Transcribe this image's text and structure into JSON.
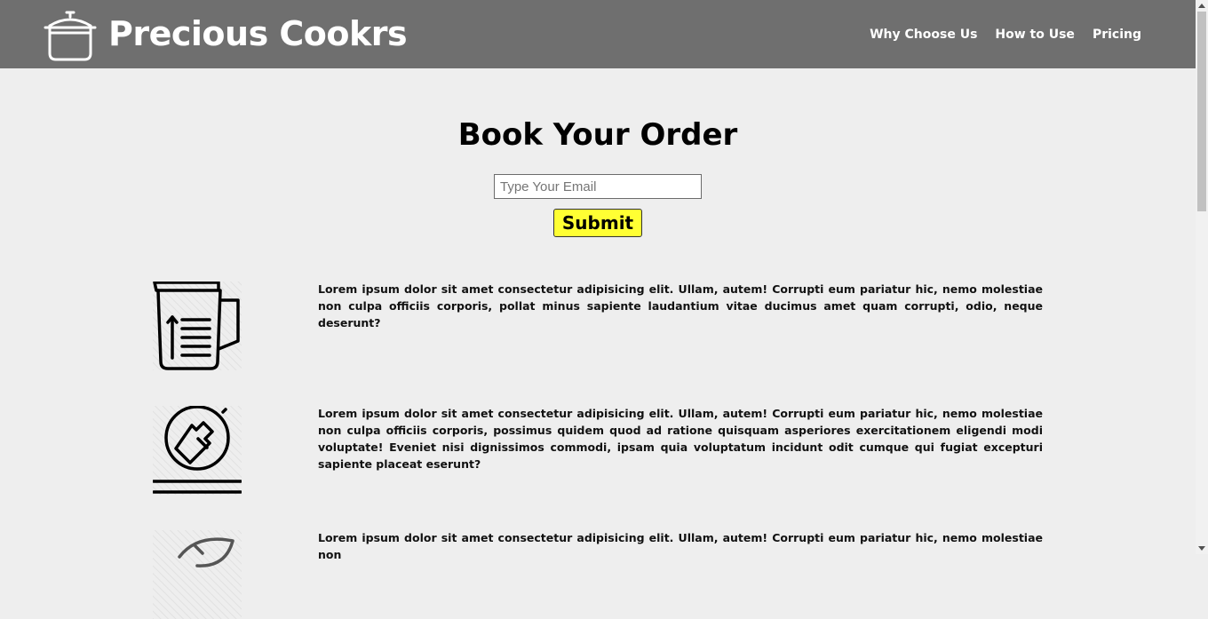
{
  "header": {
    "brand": "Precious Cookrs",
    "logo_icon": "cooking-pot-icon",
    "nav": [
      "Why Choose Us",
      "How to Use",
      "Pricing"
    ]
  },
  "booking": {
    "title": "Book Your Order",
    "email_placeholder": "Type Your Email",
    "email_value": "",
    "submit_label": "Submit"
  },
  "features": [
    {
      "icon": "measuring-cup-icon",
      "text": "Lorem ipsum dolor sit amet consectetur adipisicing elit. Ullam, autem! Corrupti eum pariatur hic, nemo molestiae non culpa officiis corporis, pollat minus sapiente laudantium vitae ducimus amet quam corrupti, odio, neque deserunt?"
    },
    {
      "icon": "meat-tenderizer-icon",
      "text": "Lorem ipsum dolor sit amet consectetur adipisicing elit. Ullam, autem! Corrupti eum pariatur hic, nemo molestiae non culpa officiis corporis, possimus quidem quod ad ratione quisquam asperiores exercitationem eligendi modi voluptate! Eveniet nisi dignissimos commodi, ipsam quia voluptatum incidunt odit cumque qui fugiat excepturi sapiente placeat eserunt?"
    },
    {
      "icon": "herb-leaf-icon",
      "text": "Lorem ipsum dolor sit amet consectetur adipisicing elit. Ullam, autem! Corrupti eum pariatur hic, nemo molestiae non"
    }
  ],
  "colors": {
    "header_bg": "#6f6f6f",
    "page_bg": "#eeeeee",
    "submit_bg": "#ffff33"
  }
}
